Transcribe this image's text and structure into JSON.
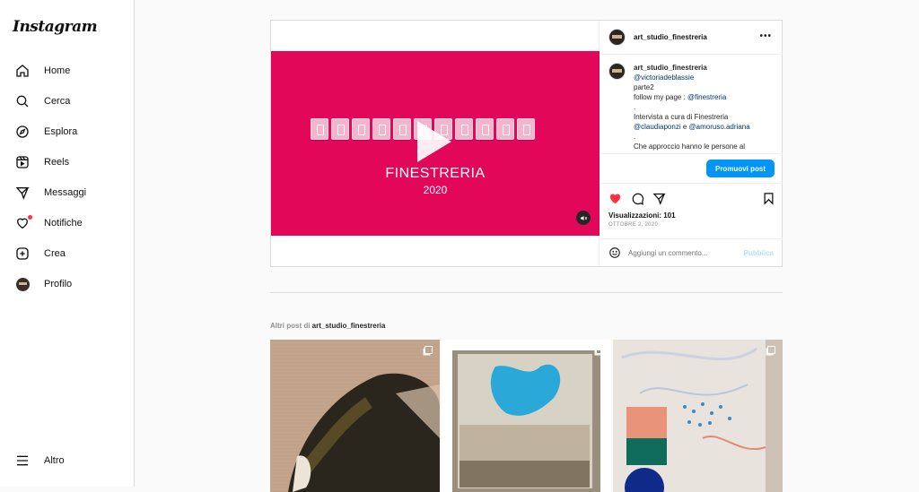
{
  "app": {
    "logo": "Instagram"
  },
  "sidebar": {
    "items": [
      {
        "label": "Home",
        "icon": "home-icon"
      },
      {
        "label": "Cerca",
        "icon": "search-icon"
      },
      {
        "label": "Esplora",
        "icon": "compass-icon"
      },
      {
        "label": "Reels",
        "icon": "reels-icon"
      },
      {
        "label": "Messaggi",
        "icon": "send-icon"
      },
      {
        "label": "Notifiche",
        "icon": "heart-icon"
      },
      {
        "label": "Crea",
        "icon": "plus-square-icon"
      },
      {
        "label": "Profilo",
        "icon": "avatar"
      }
    ],
    "more_label": "Altro"
  },
  "post": {
    "username": "art_studio_finestreria",
    "video": {
      "title": "FINESTRERIA",
      "year": "2020"
    },
    "caption": {
      "username": "art_studio_finestreria",
      "mention1": "@victoriadeblassie",
      "line_parte": "parte2",
      "line_follow": "follow my page : ",
      "follow_mention": "@finestreria",
      "dot1": ".",
      "line_intervista": "Intervista a cura di Finestreria",
      "mention2": "@claudiaponzi",
      "and_text": " e ",
      "mention3": "@amoruso.adriana",
      "dot2": ".",
      "line_approccio": "Che approccio hanno le persone al"
    },
    "promote_label": "Promuovi post",
    "views": "Visualizzazioni: 101",
    "date": "OTTOBRE 2, 2020",
    "comment_placeholder": "Aggiungi un commento...",
    "publish_label": "Pubblica"
  },
  "more_posts": {
    "prefix": "Altri post di ",
    "account": "art_studio_finestreria"
  },
  "colors": {
    "accent": "#0095f6",
    "like": "#ff3040",
    "video_bg": "#e3075a"
  }
}
